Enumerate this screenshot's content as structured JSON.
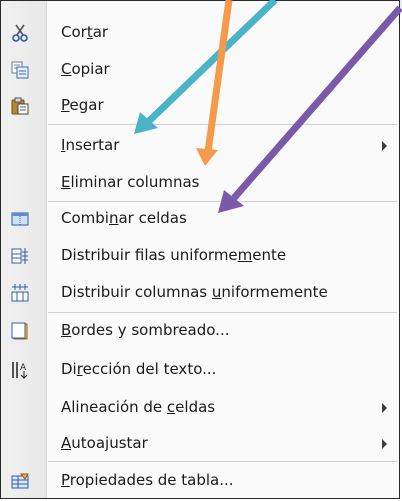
{
  "menu": {
    "items": [
      {
        "pre": "Cor",
        "key": "t",
        "post": "ar",
        "icon": "scissors-icon"
      },
      {
        "pre": "",
        "key": "C",
        "post": "opiar",
        "icon": "copy-icon"
      },
      {
        "pre": "",
        "key": "P",
        "post": "egar",
        "icon": "paste-icon"
      },
      {
        "pre": "",
        "key": "I",
        "post": "nsertar",
        "icon": ""
      },
      {
        "pre": "",
        "key": "E",
        "post": "liminar columnas",
        "icon": ""
      },
      {
        "pre": "Combi",
        "key": "n",
        "post": "ar celdas",
        "icon": "merge-cells-icon"
      },
      {
        "pre": "Distribuir filas uniforme",
        "key": "m",
        "post": "ente",
        "icon": "distribute-rows-icon"
      },
      {
        "pre": "Distribuir columnas ",
        "key": "u",
        "post": "niformemente",
        "icon": "distribute-columns-icon"
      },
      {
        "pre": "",
        "key": "B",
        "post": "ordes y sombreado...",
        "icon": "borders-shading-icon"
      },
      {
        "pre": "Di",
        "key": "r",
        "post": "ección del texto...",
        "icon": "text-direction-icon"
      },
      {
        "pre": "Alineación de ",
        "key": "c",
        "post": "eldas",
        "icon": ""
      },
      {
        "pre": "",
        "key": "A",
        "post": "utoajustar",
        "icon": ""
      },
      {
        "pre": "",
        "key": "P",
        "post": "ropiedades de tabla...",
        "icon": "table-properties-icon"
      }
    ]
  },
  "annotation_colors": {
    "teal": "#4bb3c9",
    "orange": "#f59a4a",
    "purple": "#7a5aa8"
  }
}
